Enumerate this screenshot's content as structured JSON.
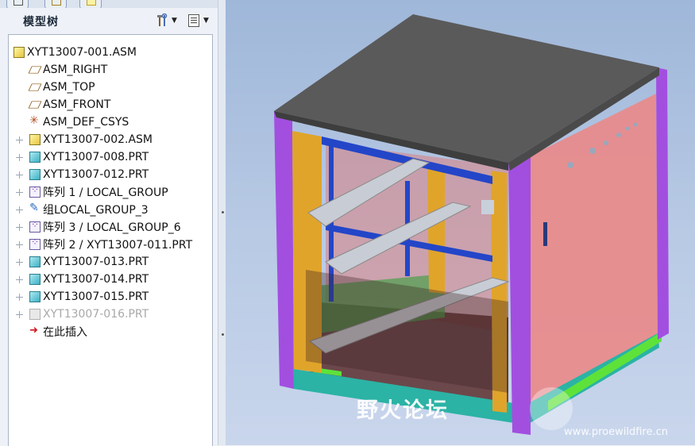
{
  "panel": {
    "title": "模型树",
    "toolbar": {
      "settings_icon": "hammer-wrench-icon",
      "show_icon": "list-icon"
    }
  },
  "tree": {
    "items": [
      {
        "label": "XYT13007-001.ASM",
        "icon": "assembly-icon",
        "expandable": false,
        "indent": 0
      },
      {
        "label": "ASM_RIGHT",
        "icon": "datum-plane-icon",
        "expandable": false,
        "indent": 1
      },
      {
        "label": "ASM_TOP",
        "icon": "datum-plane-icon",
        "expandable": false,
        "indent": 1
      },
      {
        "label": "ASM_FRONT",
        "icon": "datum-plane-icon",
        "expandable": false,
        "indent": 1
      },
      {
        "label": "ASM_DEF_CSYS",
        "icon": "csys-icon",
        "expandable": false,
        "indent": 1
      },
      {
        "label": "XYT13007-002.ASM",
        "icon": "assembly-icon",
        "expandable": true,
        "indent": 1
      },
      {
        "label": "XYT13007-008.PRT",
        "icon": "part-icon",
        "expandable": true,
        "indent": 1
      },
      {
        "label": "XYT13007-012.PRT",
        "icon": "part-icon",
        "expandable": true,
        "indent": 1
      },
      {
        "label": "阵列 1 / LOCAL_GROUP",
        "icon": "pattern-icon",
        "expandable": true,
        "indent": 1
      },
      {
        "label": "组LOCAL_GROUP_3",
        "icon": "group-icon",
        "expandable": true,
        "indent": 1
      },
      {
        "label": "阵列 3 / LOCAL_GROUP_6",
        "icon": "pattern-icon",
        "expandable": true,
        "indent": 1
      },
      {
        "label": "阵列 2 / XYT13007-011.PRT",
        "icon": "pattern-icon",
        "expandable": true,
        "indent": 1
      },
      {
        "label": "XYT13007-013.PRT",
        "icon": "part-icon",
        "expandable": true,
        "indent": 1
      },
      {
        "label": "XYT13007-014.PRT",
        "icon": "part-icon",
        "expandable": true,
        "indent": 1
      },
      {
        "label": "XYT13007-015.PRT",
        "icon": "part-icon",
        "expandable": true,
        "indent": 1
      },
      {
        "label": "XYT13007-016.PRT",
        "icon": "suppressed-part-icon",
        "expandable": true,
        "indent": 1,
        "dimmed": true
      },
      {
        "label": "在此插入",
        "icon": "insert-here-icon",
        "expandable": false,
        "indent": 1
      }
    ]
  },
  "watermark": {
    "text": "野火论坛",
    "url": "www.proewildfire.cn"
  },
  "colors": {
    "top_panel": "#5a5a5a",
    "side_panel": "#e98a8a",
    "uprights": "#a24fe0",
    "rails": "#e0a42a",
    "crossbars": "#2346c8",
    "base": "#2bb3a5",
    "green_strip": "#5ee23a"
  }
}
